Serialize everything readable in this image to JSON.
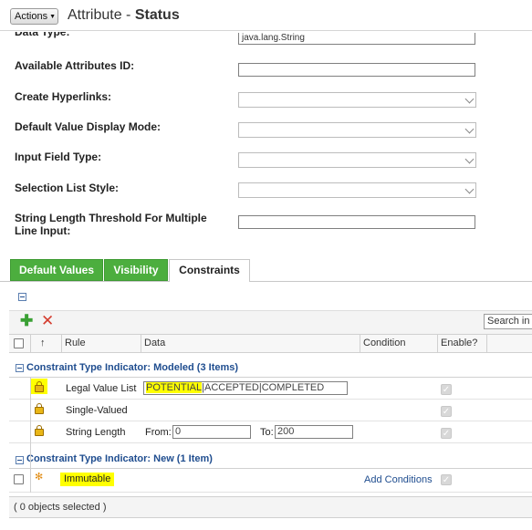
{
  "header": {
    "actions_label": "Actions",
    "title_prefix": "Attribute - ",
    "title_main": "Status"
  },
  "form": {
    "data_type_label": "Data Type:",
    "data_type_value": "java.lang.String",
    "fields": [
      {
        "label": "Available Attributes ID:",
        "kind": "text",
        "value": ""
      },
      {
        "label": "Create Hyperlinks:",
        "kind": "select",
        "value": ""
      },
      {
        "label": "Default Value Display Mode:",
        "kind": "select",
        "value": ""
      },
      {
        "label": "Input Field Type:",
        "kind": "select",
        "value": ""
      },
      {
        "label": "Selection List Style:",
        "kind": "select",
        "value": ""
      },
      {
        "label": "String Length Threshold For Multiple Line Input:",
        "kind": "text",
        "value": ""
      }
    ]
  },
  "tabs": [
    {
      "label": "Default Values",
      "active": false
    },
    {
      "label": "Visibility",
      "active": false
    },
    {
      "label": "Constraints",
      "active": true
    }
  ],
  "table": {
    "search_placeholder": "Search in table",
    "columns": {
      "sort": "↑",
      "rule": "Rule",
      "data": "Data",
      "condition": "Condition",
      "enable": "Enable?"
    },
    "groups": [
      {
        "label": "Constraint Type Indicator: Modeled (3 Items)",
        "rows": [
          {
            "rule": "Legal Value List",
            "data_value": "POTENTIAL|ACCEPTED|COMPLETED",
            "data_highlight": "POTENTIAL",
            "data_rest": "|ACCEPTED|COMPLETED"
          },
          {
            "rule": "Single-Valued"
          },
          {
            "rule": "String Length",
            "from_label": "From:",
            "from_value": "0",
            "to_label": "To:",
            "to_value": "200"
          }
        ]
      },
      {
        "label": "Constraint Type Indicator: New (1 Item)",
        "rows": [
          {
            "rule": "Immutable",
            "condition_link": "Add Conditions"
          }
        ]
      }
    ],
    "footer": "( 0 objects selected )"
  },
  "colors": {
    "tab_green": "#4cae3e",
    "link_blue": "#1f4d8f",
    "highlight": "#ffff00"
  },
  "icons": [
    "chevron-down-icon",
    "collapse-icon",
    "add-icon",
    "delete-icon",
    "lock-icon",
    "new-item-icon",
    "checkbox-icon"
  ]
}
